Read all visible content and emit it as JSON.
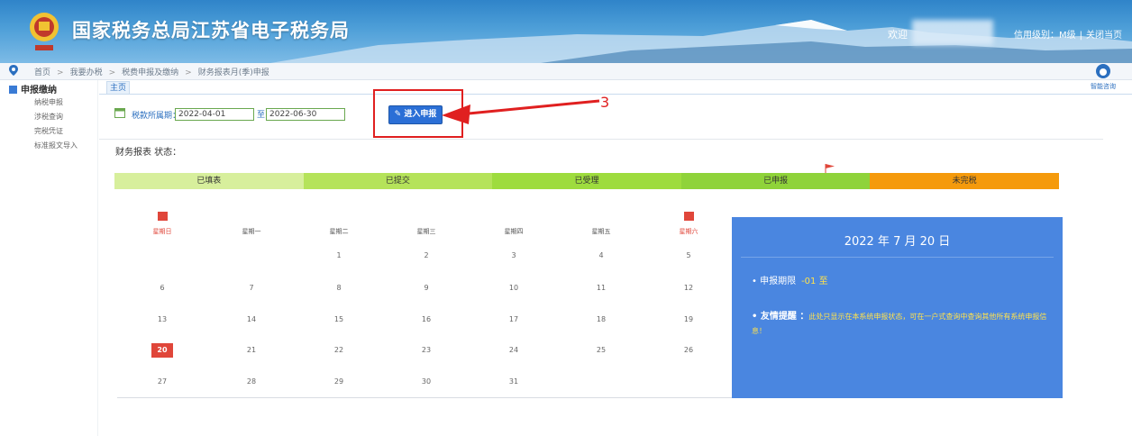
{
  "header": {
    "site_title": "国家税务总局江苏省电子税务局",
    "welcome": "欢迎",
    "credit": "信用级别：M级",
    "separator": "|",
    "close_link": "关闭当页"
  },
  "breadcrumb": [
    "首页",
    "我要办税",
    "税费申报及缴纳",
    "财务报表月(季)申报"
  ],
  "sidebar": {
    "title": "申报缴纳",
    "items": [
      "纳税申报",
      "涉税查询",
      "完税凭证",
      "标准报文导入"
    ]
  },
  "tab": {
    "label": "主页"
  },
  "help": {
    "label": "智能咨询"
  },
  "period": {
    "label": "税款所属期：",
    "start": "2022-04-01",
    "to": "至",
    "end": "2022-06-30"
  },
  "enter_button": {
    "label": "进入申报"
  },
  "annotation": {
    "step": "3"
  },
  "status": {
    "title": "财务报表 状态：",
    "stages": [
      {
        "label": "已填表",
        "color": "#d7ef9c"
      },
      {
        "label": "已提交",
        "color": "#b5e35a"
      },
      {
        "label": "已受理",
        "color": "#9edc3e"
      },
      {
        "label": "已申报",
        "color": "#8fd33a"
      },
      {
        "label": "未完税",
        "color": "#f59a0c"
      }
    ]
  },
  "calendar": {
    "weekdays": [
      "星期日",
      "星期一",
      "星期二",
      "星期三",
      "星期四",
      "星期五",
      "星期六"
    ],
    "weeks": [
      [
        "",
        "",
        "1",
        "2",
        "3",
        "4",
        "5"
      ],
      [
        "6",
        "7",
        "8",
        "9",
        "10",
        "11",
        "12"
      ],
      [
        "13",
        "14",
        "15",
        "16",
        "17",
        "18",
        "19"
      ],
      [
        "20",
        "21",
        "22",
        "23",
        "24",
        "25",
        "26"
      ],
      [
        "27",
        "28",
        "29",
        "30",
        "31",
        "",
        ""
      ]
    ],
    "today": "20"
  },
  "info": {
    "date": "2022 年 7 月 20 日",
    "deadline_label": "• 申报期限",
    "deadline_value": "-01 至",
    "reminder_label": "• 友情提醒 ：",
    "reminder_text": "此处只显示在本系统申报状态，可在一户式查询中查询其他所有系统申报信息！"
  }
}
